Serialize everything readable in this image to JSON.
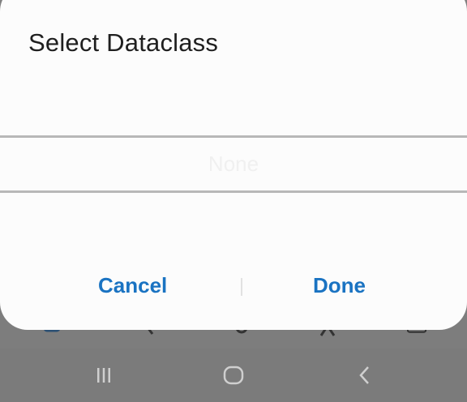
{
  "dialog": {
    "title": "Select Dataclass",
    "picker": {
      "selected_value": "None"
    },
    "buttons": {
      "cancel_label": "Cancel",
      "done_label": "Done"
    }
  },
  "background_toolbar": {
    "icons": [
      "document-icon",
      "back-chevron-icon",
      "gear-icon",
      "star-icon",
      "window-icon"
    ]
  },
  "navigation_bar": {
    "icons": [
      "recent-apps-icon",
      "home-icon",
      "back-icon"
    ]
  },
  "colors": {
    "accent": "#1a73c2",
    "dialog_background": "#fcfcfc",
    "scrim": "#818181",
    "title_text": "#1f1f1f"
  }
}
